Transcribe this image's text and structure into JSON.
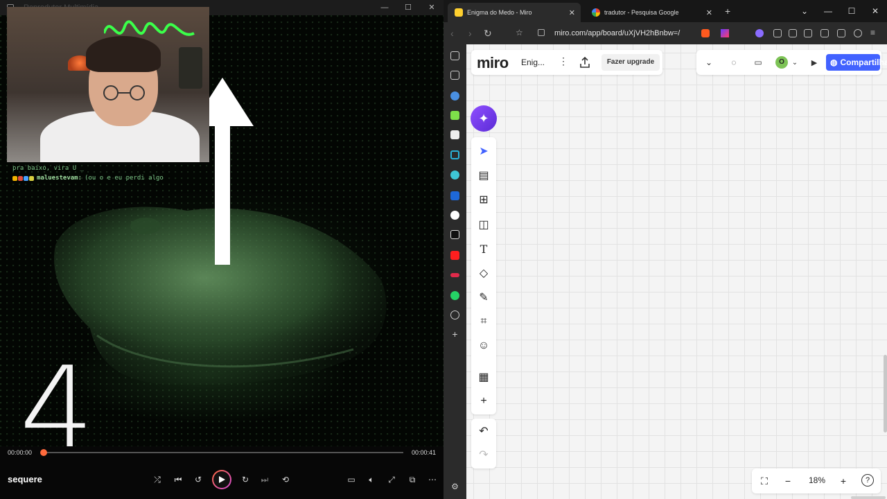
{
  "player": {
    "window_title": "Reprodutor Multimídia",
    "chat": [
      {
        "user": "",
        "message": "pra baixo, vira U _"
      },
      {
        "user": "maluestevam:",
        "message": "(ou o e eu perdi algo"
      }
    ],
    "countdown": "4",
    "time_current": "00:00:00",
    "time_total": "00:00:41",
    "progress_fraction": 0.0,
    "track_name": "sequere",
    "accent_color": "#ff6a3c"
  },
  "browser": {
    "tabs": [
      {
        "title": "Enigma do Medo - Miro",
        "active": true,
        "icon": "miro-icon"
      },
      {
        "title": "tradutor - Pesquisa Google",
        "active": false,
        "icon": "google-icon"
      }
    ],
    "url": "miro.com/app/board/uXjVH2hBnbw=/"
  },
  "miro": {
    "logo": "miro",
    "board_name": "Enig...",
    "upgrade_label": "Fazer upgrade",
    "avatar_initial": "O",
    "share_label": "Compartilhar",
    "zoom_level": "18%",
    "brand_color": "#4262ff"
  }
}
